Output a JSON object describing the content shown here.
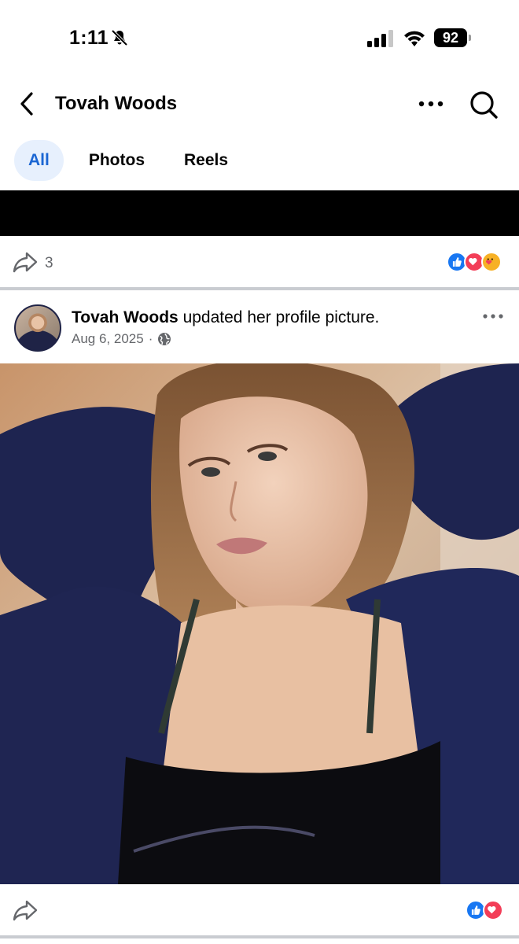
{
  "status_bar": {
    "time": "1:11",
    "battery": "92",
    "icons": [
      "bell-slash-icon",
      "signal-icon",
      "wifi-icon",
      "battery-icon"
    ]
  },
  "header": {
    "title": "Tovah Woods",
    "icons": [
      "back-icon",
      "more-icon",
      "search-icon"
    ]
  },
  "tabs": [
    {
      "label": "All",
      "active": true
    },
    {
      "label": "Photos",
      "active": false
    },
    {
      "label": "Reels",
      "active": false
    }
  ],
  "first_post": {
    "share_count": "3",
    "reactions": [
      "like",
      "love",
      "care"
    ]
  },
  "post": {
    "author": "Tovah Woods",
    "action": " updated her profile picture.",
    "date": "Aug 6, 2025",
    "separator": "·",
    "audience_icon": "globe-icon",
    "photo_icon": "profile-photo",
    "reactions": [
      "like",
      "love"
    ]
  },
  "colors": {
    "accent": "#1b66d3",
    "tab_active_bg": "#e7f0fd",
    "like": "#1877f2",
    "love": "#f33e58",
    "care": "#f7b125",
    "muted_text": "#65676b"
  }
}
